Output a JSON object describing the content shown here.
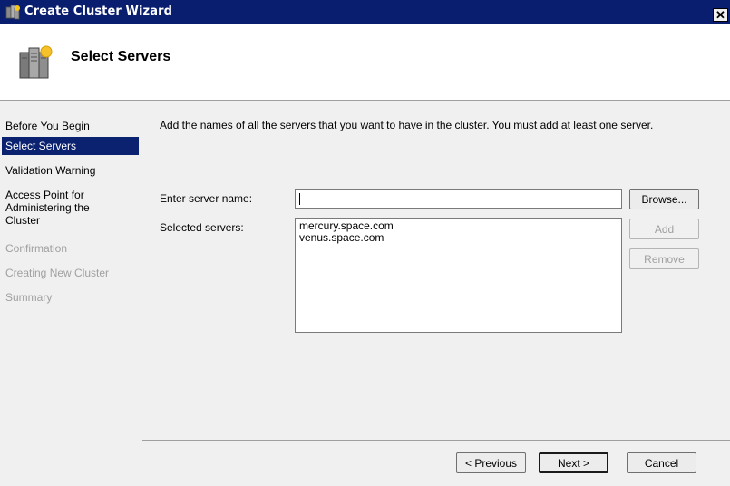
{
  "window": {
    "title": "Create Cluster Wizard",
    "close_symbol": "✕",
    "icon": "cluster-icon"
  },
  "header": {
    "title": "Select Servers",
    "icon": "servers-icon"
  },
  "nav": {
    "items": [
      {
        "label": "Before You Begin",
        "state": "normal"
      },
      {
        "label": "Select Servers",
        "state": "active"
      },
      {
        "label": "Validation Warning",
        "state": "normal"
      },
      {
        "label": "Access Point for Administering the Cluster",
        "state": "normal"
      },
      {
        "label": "Confirmation",
        "state": "disabled"
      },
      {
        "label": "Creating New Cluster",
        "state": "disabled"
      },
      {
        "label": "Summary",
        "state": "disabled"
      }
    ]
  },
  "content": {
    "instructions": "Add the names of all the servers that you want to have in the cluster. You must add at least one server.",
    "server_name_label": "Enter server name:",
    "server_name_value": "",
    "selected_label": "Selected servers:",
    "selected_servers": [
      "mercury.space.com",
      "venus.space.com"
    ],
    "browse_label": "Browse...",
    "add_label": "Add",
    "remove_label": "Remove"
  },
  "footer": {
    "previous_label": "< Previous",
    "next_label": "Next >",
    "cancel_label": "Cancel"
  },
  "colors": {
    "titlebar": "#0a1e70",
    "nav_active": "#0a2270",
    "dialog_bg": "#f0f0f0"
  }
}
